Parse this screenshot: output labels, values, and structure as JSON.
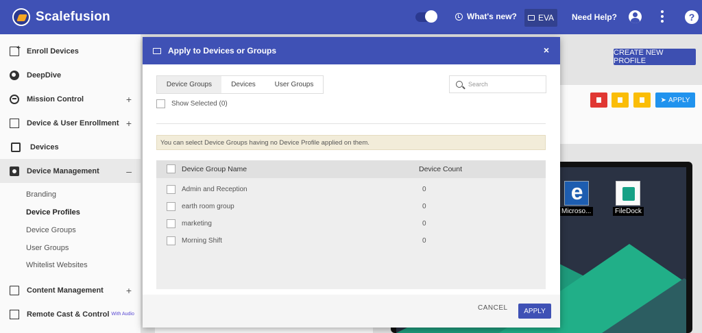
{
  "topbar": {
    "brand": "Scalefusion",
    "whats_new": "What's new?",
    "eva": "EVA",
    "need_help": "Need Help?",
    "help_glyph": "?"
  },
  "sidebar": {
    "items": [
      {
        "label": "Enroll Devices",
        "icon": "enroll-devices-icon"
      },
      {
        "label": "DeepDive",
        "icon": "deepdive-icon"
      },
      {
        "label": "Mission Control",
        "icon": "mission-control-icon",
        "expand": "+"
      },
      {
        "label": "Device & User Enrollment",
        "icon": "device-user-enrollment-icon",
        "expand": "+"
      },
      {
        "label": "Devices",
        "icon": "phone-icon"
      },
      {
        "label": "Device Management",
        "icon": "briefcase-icon",
        "expand": "–"
      },
      {
        "label": "Content Management",
        "icon": "folder-icon",
        "expand": "+"
      },
      {
        "label": "Remote Cast & Control",
        "icon": "cast-icon",
        "badge": "With Audio"
      }
    ],
    "sub_items": [
      "Branding",
      "Device Profiles",
      "Device Groups",
      "User Groups",
      "Whitelist Websites"
    ]
  },
  "main": {
    "create_button": "CREATE NEW PROFILE",
    "apply_button": "APPLY",
    "apps": [
      {
        "label": "Microso...",
        "icon": "edge-icon"
      },
      {
        "label": "FileDock",
        "icon": "filedock-icon"
      }
    ]
  },
  "modal": {
    "title": "Apply to Devices or Groups",
    "close": "×",
    "tabs": [
      "Device Groups",
      "Devices",
      "User Groups"
    ],
    "search_placeholder": "Search",
    "show_selected": "Show Selected (0)",
    "info": "You can select Device Groups having no Device Profile applied on them.",
    "columns": [
      "Device Group Name",
      "Device Count"
    ],
    "rows": [
      {
        "name": "Admin and Reception",
        "count": "0"
      },
      {
        "name": "earth room group",
        "count": "0"
      },
      {
        "name": "marketing",
        "count": "0"
      },
      {
        "name": "Morning Shift",
        "count": "0"
      }
    ],
    "cancel": "CANCEL",
    "apply": "APPLY"
  },
  "colors": {
    "primary": "#3f51b5",
    "danger": "#e53935",
    "warning": "#ffc107",
    "info": "#2196f3",
    "notice_bg": "#f2ecd9"
  }
}
